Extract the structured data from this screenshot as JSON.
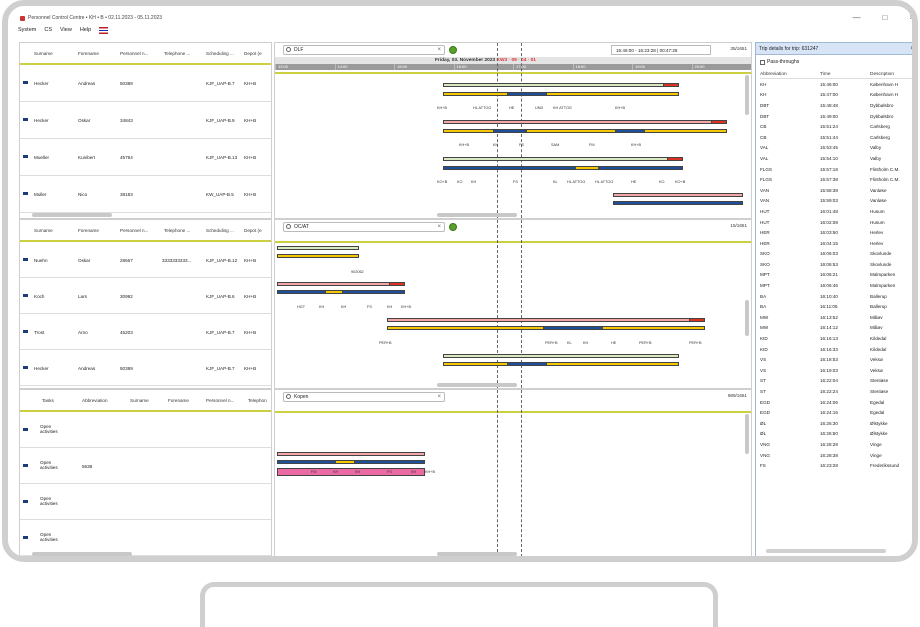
{
  "window": {
    "title": "Personnel Control Centre • KH • B • 02.11.2023 - 05.11.2023",
    "minimize": "—",
    "maximize": "□",
    "close": "×"
  },
  "menu": [
    "System",
    "CS",
    "View",
    "Help"
  ],
  "colors": {
    "accent_line": "#ccd040",
    "bar_yellow": "#f3c800",
    "bar_blue": "#1d4f9a",
    "bar_pink": "#f4a7a7",
    "bar_magenta": "#ec6aa3",
    "bar_red": "#d32"
  },
  "staff_columns": [
    "Surname",
    "Forename",
    "Personnel n...",
    "Telephone ...",
    "Scheduling ...",
    "Depot (e"
  ],
  "tasks_columns": [
    "Tasks",
    "Abbreviation",
    "Surname",
    "Forename",
    "Personnel n...",
    "Telephon"
  ],
  "pane1": {
    "search": "DLF",
    "time_range": "15:46:00 - 16:23:28 | 00:47:28",
    "counter": "35/1651",
    "date": "Friday, 03. November 2023",
    "date_highlight": "KW3 · 09 · 04 · 01",
    "ticks": [
      "13:00",
      "14:00",
      "15:00",
      "16:00",
      "17:00",
      "18:00",
      "19:00",
      "20:00"
    ],
    "rows": [
      {
        "surname": "Hecker",
        "forename": "Andreas",
        "personnel": "50389",
        "telephone": "",
        "scheduling": "KJF_UAP-B.7",
        "depot": "KH+B"
      },
      {
        "surname": "Hecker",
        "forename": "Oskar",
        "personnel": "34843",
        "telephone": "",
        "scheduling": "KJF_UAP-B.9",
        "depot": "KH+B"
      },
      {
        "surname": "Mueller",
        "forename": "Kunibert",
        "personnel": "45764",
        "telephone": "",
        "scheduling": "KJF_UAP-B.13",
        "depot": "KH+B"
      },
      {
        "surname": "Muller",
        "forename": "Nico",
        "personnel": "38183",
        "telephone": "",
        "scheduling": "KW_UAP-B.5",
        "depot": "KH+B"
      }
    ],
    "stops": [
      [
        "KH+B",
        "HL ATTOG",
        "HE",
        "UND",
        "KH ATTOG",
        "KH+B"
      ],
      [
        "KH+B",
        "KH",
        "FS",
        "SAM",
        "FM",
        "KH+B"
      ],
      [
        "KO+B",
        "KO",
        "KH",
        "FS",
        "KL",
        "HL ATTOG",
        "HL ATTOG",
        "HE",
        "KO",
        "KO+B"
      ]
    ]
  },
  "pane2": {
    "search": "OC/AT",
    "counter": "15/1651",
    "rows": [
      {
        "surname": "Nuehn",
        "forename": "Oskar",
        "personnel": "28667",
        "telephone": "3333333333...",
        "scheduling": "KJF_UAP-B.12",
        "depot": "KH+B"
      },
      {
        "surname": "Koch",
        "forename": "Lars",
        "personnel": "30992",
        "telephone": "",
        "scheduling": "KJF_UAP-B.6",
        "depot": "KH+B"
      },
      {
        "surname": "Trost",
        "forename": "Arno",
        "personnel": "45203",
        "telephone": "",
        "scheduling": "KJF_UAP-B.7",
        "depot": "KH+B"
      },
      {
        "surname": "Hecker",
        "forename": "Andreas",
        "personnel": "50389",
        "telephone": "",
        "scheduling": "KJF_UAP-B.7",
        "depot": "KH+B"
      }
    ],
    "stops": [
      [
        "902062"
      ],
      [
        "HGT",
        "KH",
        "KH",
        "FS",
        "KH",
        "KH+B"
      ],
      [
        "PER+B",
        "PER+B",
        "KL",
        "KH",
        "HE",
        "PER+B",
        "PER+B"
      ]
    ]
  },
  "pane3": {
    "search": "Kopen",
    "counter": "989/1651",
    "rows": [
      {
        "task": "Open activities",
        "abbreviation": ""
      },
      {
        "task": "Open activities",
        "abbreviation": "5638"
      },
      {
        "task": "Open activities",
        "abbreviation": ""
      },
      {
        "task": "Open activities",
        "abbreviation": ""
      }
    ],
    "stops": [
      "FM",
      "KH",
      "KH",
      "FS",
      "KH",
      "KH+B"
    ]
  },
  "trip": {
    "title": "Trip details for trip: 631247",
    "pass_through_label": "Pass-throughs",
    "columns": [
      "Abbreviation",
      "Time",
      "Description"
    ],
    "rows": [
      [
        "KH",
        "15:46:00",
        "København H"
      ],
      [
        "KH",
        "15:47:00",
        "København H"
      ],
      [
        "DBT",
        "15:48:48",
        "Dybbølsbro"
      ],
      [
        "DBT",
        "15:49:00",
        "Dybbølsbro"
      ],
      [
        "CB",
        "15:51:24",
        "Carlsberg"
      ],
      [
        "CB",
        "15:51:44",
        "Carlsberg"
      ],
      [
        "VAL",
        "15:53:45",
        "Valby"
      ],
      [
        "VAL",
        "15:54:10",
        "Valby"
      ],
      [
        "FLGS",
        "15:57:18",
        "Flintholm C.M."
      ],
      [
        "FLGS",
        "15:57:38",
        "Flintholm C.M."
      ],
      [
        "VAN",
        "15:58:38",
        "Vanløse"
      ],
      [
        "VAN",
        "15:59:03",
        "Vanløse"
      ],
      [
        "HUT",
        "16:01:48",
        "Husum"
      ],
      [
        "HUT",
        "16:02:08",
        "Husum"
      ],
      [
        "HER",
        "16:03:50",
        "Herlev"
      ],
      [
        "HER",
        "16:04:15",
        "Herlev"
      ],
      [
        "SKO",
        "16:06:03",
        "Skovlunde"
      ],
      [
        "SKO",
        "16:06:53",
        "Skovlunde"
      ],
      [
        "MPT",
        "16:06:21",
        "Malmparken"
      ],
      [
        "MPT",
        "16:06:46",
        "Malmparken"
      ],
      [
        "BA",
        "16:10:40",
        "Ballerup"
      ],
      [
        "BA",
        "16:11:05",
        "Ballerup"
      ],
      [
        "MW",
        "16:13:52",
        "Måløv"
      ],
      [
        "MW",
        "16:14:12",
        "Måløv"
      ],
      [
        "KID",
        "16:16:13",
        "Kildedal"
      ],
      [
        "KID",
        "16:16:33",
        "Kildedal"
      ],
      [
        "VS",
        "16:18:53",
        "Veksø"
      ],
      [
        "VS",
        "16:19:03",
        "Veksø"
      ],
      [
        "ST",
        "16:22:04",
        "Stenløse"
      ],
      [
        "ST",
        "16:22:24",
        "Stenløse"
      ],
      [
        "EGD",
        "16:24:06",
        "Egedal"
      ],
      [
        "EGD",
        "16:24:16",
        "Egedal"
      ],
      [
        "ØL",
        "16:26:30",
        "Ølstykke"
      ],
      [
        "ØL",
        "16:26:50",
        "Ølstykke"
      ],
      [
        "VNG",
        "16:28:28",
        "Vinge"
      ],
      [
        "VNG",
        "16:28:38",
        "Vinge"
      ],
      [
        "FS",
        "16:23:28",
        "Frederikssund"
      ]
    ]
  }
}
